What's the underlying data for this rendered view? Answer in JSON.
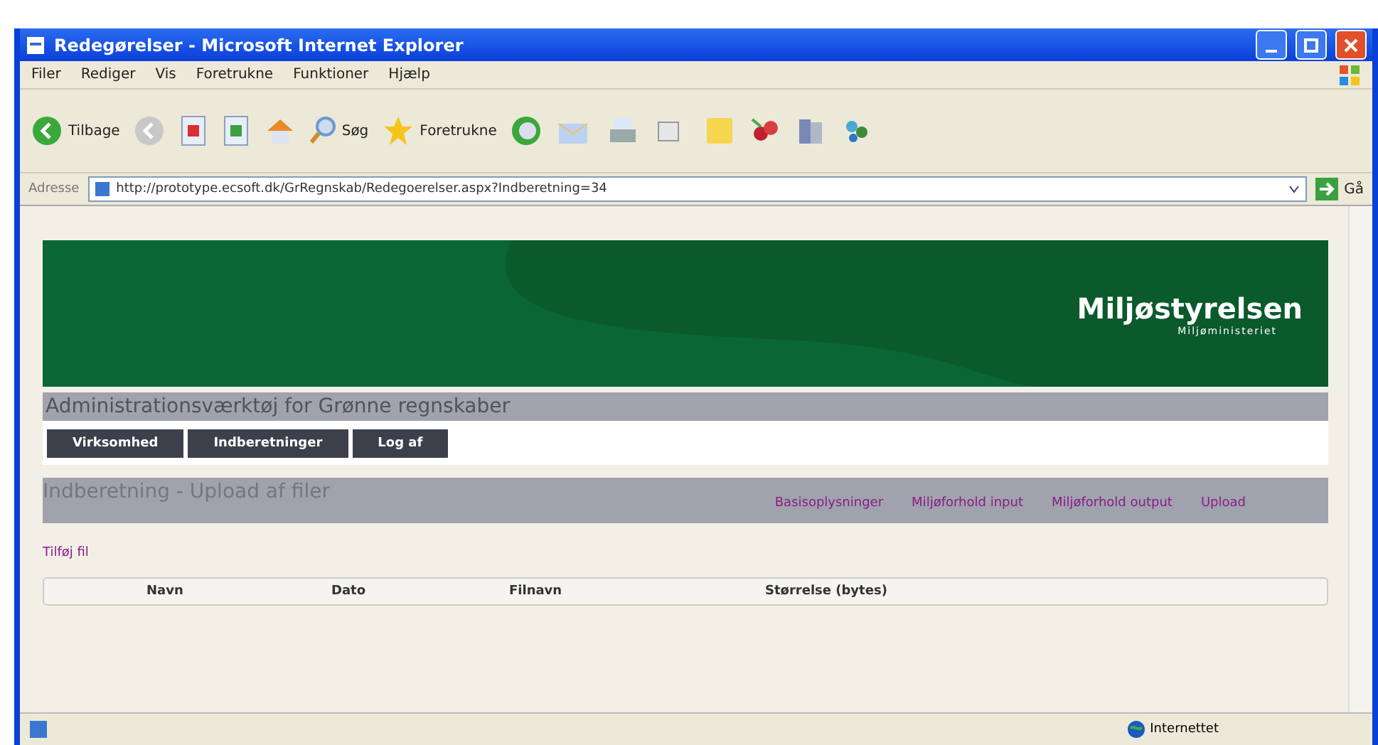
{
  "window": {
    "title": "Redegørelser - Microsoft Internet Explorer"
  },
  "menu": [
    "Filer",
    "Rediger",
    "Vis",
    "Foretrukne",
    "Funktioner",
    "Hjælp"
  ],
  "toolbar": {
    "back": "Tilbage",
    "search": "Søg",
    "favorites": "Foretrukne"
  },
  "address": {
    "label": "Adresse",
    "url": "http://prototype.ecsoft.dk/GrRegnskab/Redegoerelser.aspx?Indberetning=34",
    "go": "Gå"
  },
  "banner": {
    "logo": "Miljøstyrelsen",
    "sublogo": "Miljøministeriet"
  },
  "app_title": "Administrationsværktøj for Grønne regnskaber",
  "nav_tabs": [
    {
      "label": "Virksomhed"
    },
    {
      "label": "Indberetninger"
    },
    {
      "label": "Log af"
    }
  ],
  "section": {
    "title": "Indberetning - Upload af filer",
    "links": [
      "Basisoplysninger",
      "Miljøforhold input",
      "Miljøforhold output",
      "Upload"
    ]
  },
  "add_file_link": "Tilføj fil",
  "table": {
    "columns": [
      "Navn",
      "Dato",
      "Filnavn",
      "Størrelse (bytes)"
    ]
  },
  "status_bar": {
    "zone": "Internettet"
  }
}
